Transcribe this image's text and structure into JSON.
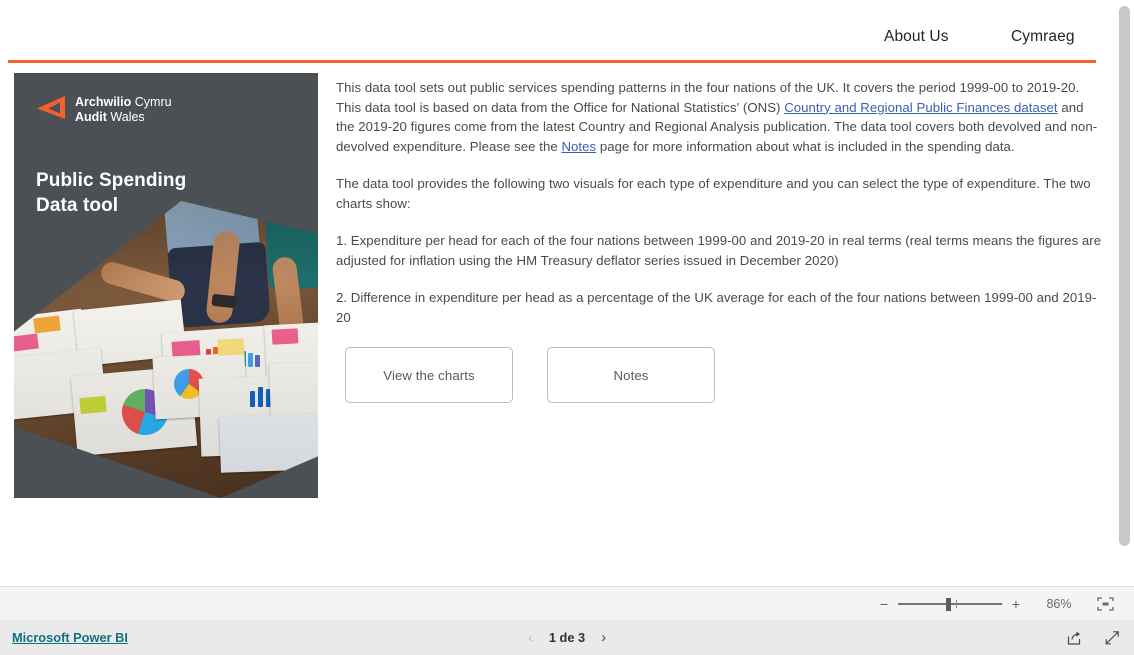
{
  "nav": {
    "about_label": "About Us",
    "cymraeg_label": "Cymraeg"
  },
  "accent_color": "#F4602C",
  "hero": {
    "logo_line1_bold": "Archwilio",
    "logo_line1_light": "Cymru",
    "logo_line2_bold": "Audit",
    "logo_line2_light": "Wales",
    "logo_icon": "triangle-left-orange-icon",
    "title_line1": "Public Spending",
    "title_line2": "Data tool",
    "photo_alt": "people-reviewing-charts-on-table-photo",
    "background_color": "#4B5055"
  },
  "intro": {
    "p1_a": "This data tool sets out public services spending patterns in the four nations of the UK. It covers the period 1999-00 to 2019-20. This data tool is based on data from the Office for National Statistics' (ONS) ",
    "p1_link1": "Country and Regional Public Finances dataset",
    "p1_b": " and the 2019-20 figures come from the latest Country and Regional Analysis publication. The data tool covers both devolved and non-devolved expenditure. Please see the ",
    "p1_link2": "Notes",
    "p1_c": " page for more information about what is included in the spending data.",
    "p2": "The data tool provides the following two visuals for each type of expenditure and you can select the type of expenditure. The two charts show:",
    "p3": "1. Expenditure per head for each of the four nations between 1999-00 and 2019-20 in real terms (real terms means the figures are adjusted for inflation using the HM Treasury deflator series issued in December 2020)",
    "p4": "2. Difference in expenditure per head as a percentage of the UK average for each of the four nations between 1999-00 and 2019-20"
  },
  "buttons": {
    "view_charts_label": "View the charts",
    "notes_label": "Notes"
  },
  "zoom_bar": {
    "minus_label": "−",
    "plus_label": "+",
    "percent_label": "86%",
    "fit_icon": "fit-to-screen-icon"
  },
  "footer": {
    "powerbi_label": "Microsoft Power BI",
    "prev_icon": "chevron-left-icon",
    "next_icon": "chevron-right-icon",
    "page_label": "1 de 3",
    "share_icon": "share-icon",
    "fullscreen_icon": "fullscreen-expand-icon"
  }
}
